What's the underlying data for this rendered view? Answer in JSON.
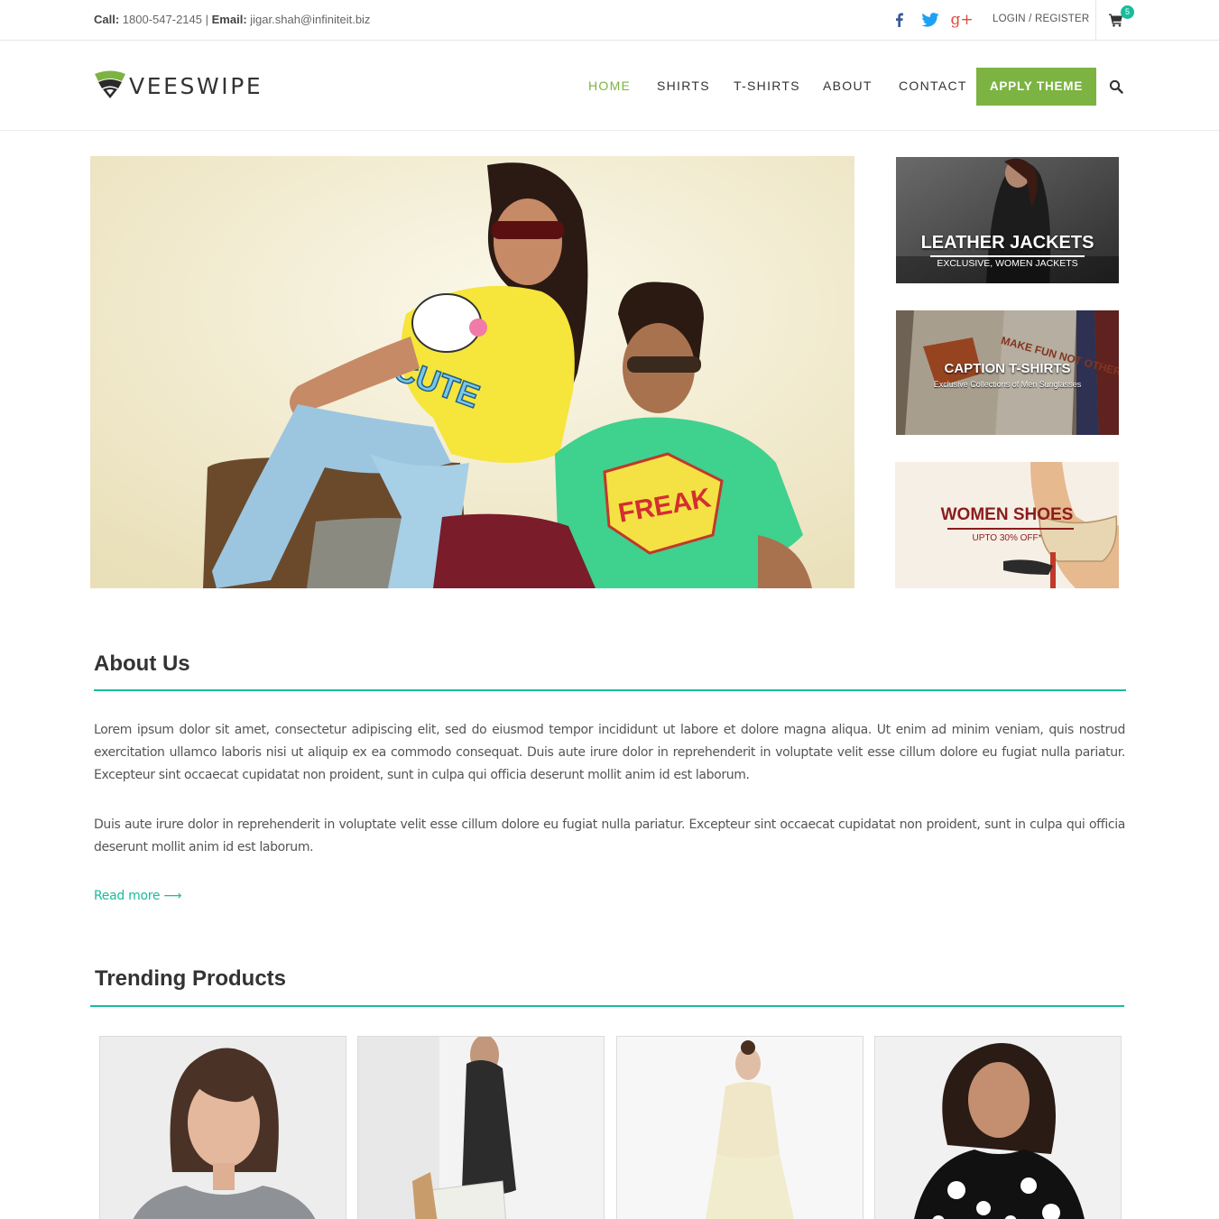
{
  "topbar": {
    "call_label": "Call:",
    "phone": "1800-547-2145",
    "separator": "|",
    "email_label": "Email:",
    "email": "jigar.shah@infiniteit.biz",
    "social_icons": [
      "facebook-icon",
      "twitter-icon",
      "google-plus-icon"
    ],
    "google_plus_text": "g+",
    "login_register": "LOGIN / REGISTER",
    "cart_count": "5"
  },
  "header": {
    "brand": "VEESWIPE",
    "nav": [
      {
        "label": "HOME",
        "active": true
      },
      {
        "label": "SHIRTS",
        "active": false
      },
      {
        "label": "T-SHIRTS",
        "active": false
      },
      {
        "label": "ABOUT",
        "active": false
      },
      {
        "label": "CONTACT",
        "active": false
      }
    ],
    "cta": "APPLY THEME"
  },
  "promos": [
    {
      "title": "LEATHER JACKETS",
      "subtitle": "EXCLUSIVE, WOMEN JACKETS"
    },
    {
      "title": "CAPTION T-SHIRTS",
      "subtitle": "Exclusive Collections of Men Sunglasses"
    },
    {
      "title": "WOMEN SHOES",
      "subtitle": "UPTO 30% OFF*"
    }
  ],
  "hero_art": {
    "tee_left_text": "CUTE",
    "tee_right_text": "FREAK"
  },
  "promo_art": {
    "tee_print": "MAKE FUN NOT OTHER"
  },
  "about": {
    "heading": "About Us",
    "paragraph1": "Lorem ipsum dolor sit amet, consectetur adipiscing elit, sed do eiusmod tempor incididunt ut labore et dolore magna aliqua. Ut enim ad minim veniam, quis nostrud exercitation ullamco laboris nisi ut aliquip ex ea commodo consequat. Duis aute irure dolor in reprehenderit in voluptate velit esse cillum dolore eu fugiat nulla pariatur. Excepteur sint occaecat cupidatat non proident, sunt in culpa qui officia deserunt mollit anim id est laborum.",
    "paragraph2": "Duis aute irure dolor in reprehenderit in voluptate velit esse cillum dolore eu fugiat nulla pariatur. Excepteur sint occaecat cupidatat non proident, sunt in culpa qui officia deserunt mollit anim id est laborum.",
    "read_more": "Read more ⟶"
  },
  "trending": {
    "heading": "Trending Products"
  },
  "colors": {
    "accent_green": "#7cb342",
    "teal": "#1abc9c",
    "text_dark": "#333333"
  }
}
